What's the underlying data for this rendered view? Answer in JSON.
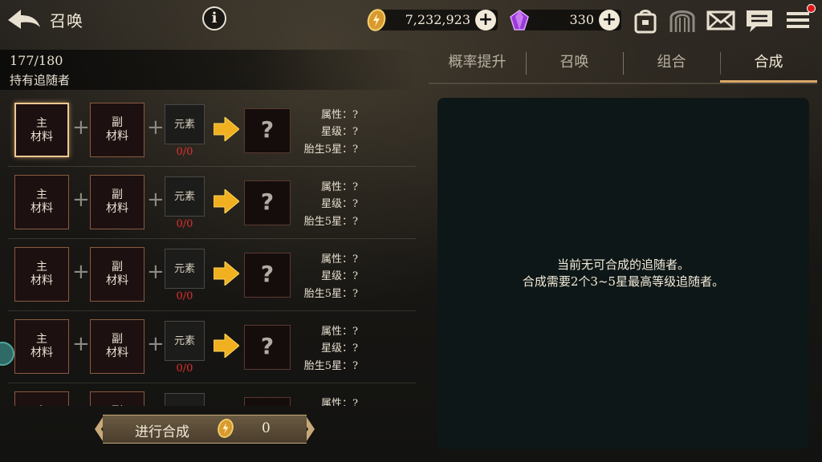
{
  "header": {
    "title": "召唤",
    "info_label": "i",
    "gold": "7,232,923",
    "gems": "330",
    "plus_label": "+"
  },
  "followers": {
    "count": "177/180",
    "label": "持有追随者"
  },
  "slot_labels": {
    "main": [
      "主",
      "材料"
    ],
    "sub": [
      "副",
      "材料"
    ],
    "element": "元素",
    "result": "?"
  },
  "rows": [
    {
      "element_count": "0/0",
      "attr": "属性：?",
      "star": "星级：?",
      "born": "胎生5星：?"
    },
    {
      "element_count": "0/0",
      "attr": "属性：?",
      "star": "星级：?",
      "born": "胎生5星：?"
    },
    {
      "element_count": "0/0",
      "attr": "属性：?",
      "star": "星级：?",
      "born": "胎生5星：?"
    },
    {
      "element_count": "0/0",
      "attr": "属性：?",
      "star": "星级：?",
      "born": "胎生5星：?"
    },
    {
      "element_count": "",
      "attr": "属性：?",
      "star": "",
      "born": ""
    }
  ],
  "synthesize": {
    "label": "进行合成",
    "cost": "0"
  },
  "tabs": [
    {
      "label": "概率提升",
      "active": false
    },
    {
      "label": "召唤",
      "active": false
    },
    {
      "label": "组合",
      "active": false
    },
    {
      "label": "合成",
      "active": true
    }
  ],
  "message": {
    "line1": "当前无可合成的追随者。",
    "line2": "合成需要2个3~5星最高等级追随者。"
  },
  "colors": {
    "accent": "#d8a868",
    "element_count": "#e03030",
    "panel": "#0e1717",
    "notify": "#e01818"
  },
  "icons": {
    "back": "back-arrow-icon",
    "gold": "gold-coin-icon",
    "gem": "purple-gem-icon",
    "bag": "bag-icon",
    "gate": "gate-icon",
    "mail": "mail-icon",
    "chat": "chat-icon",
    "menu": "menu-icon"
  }
}
